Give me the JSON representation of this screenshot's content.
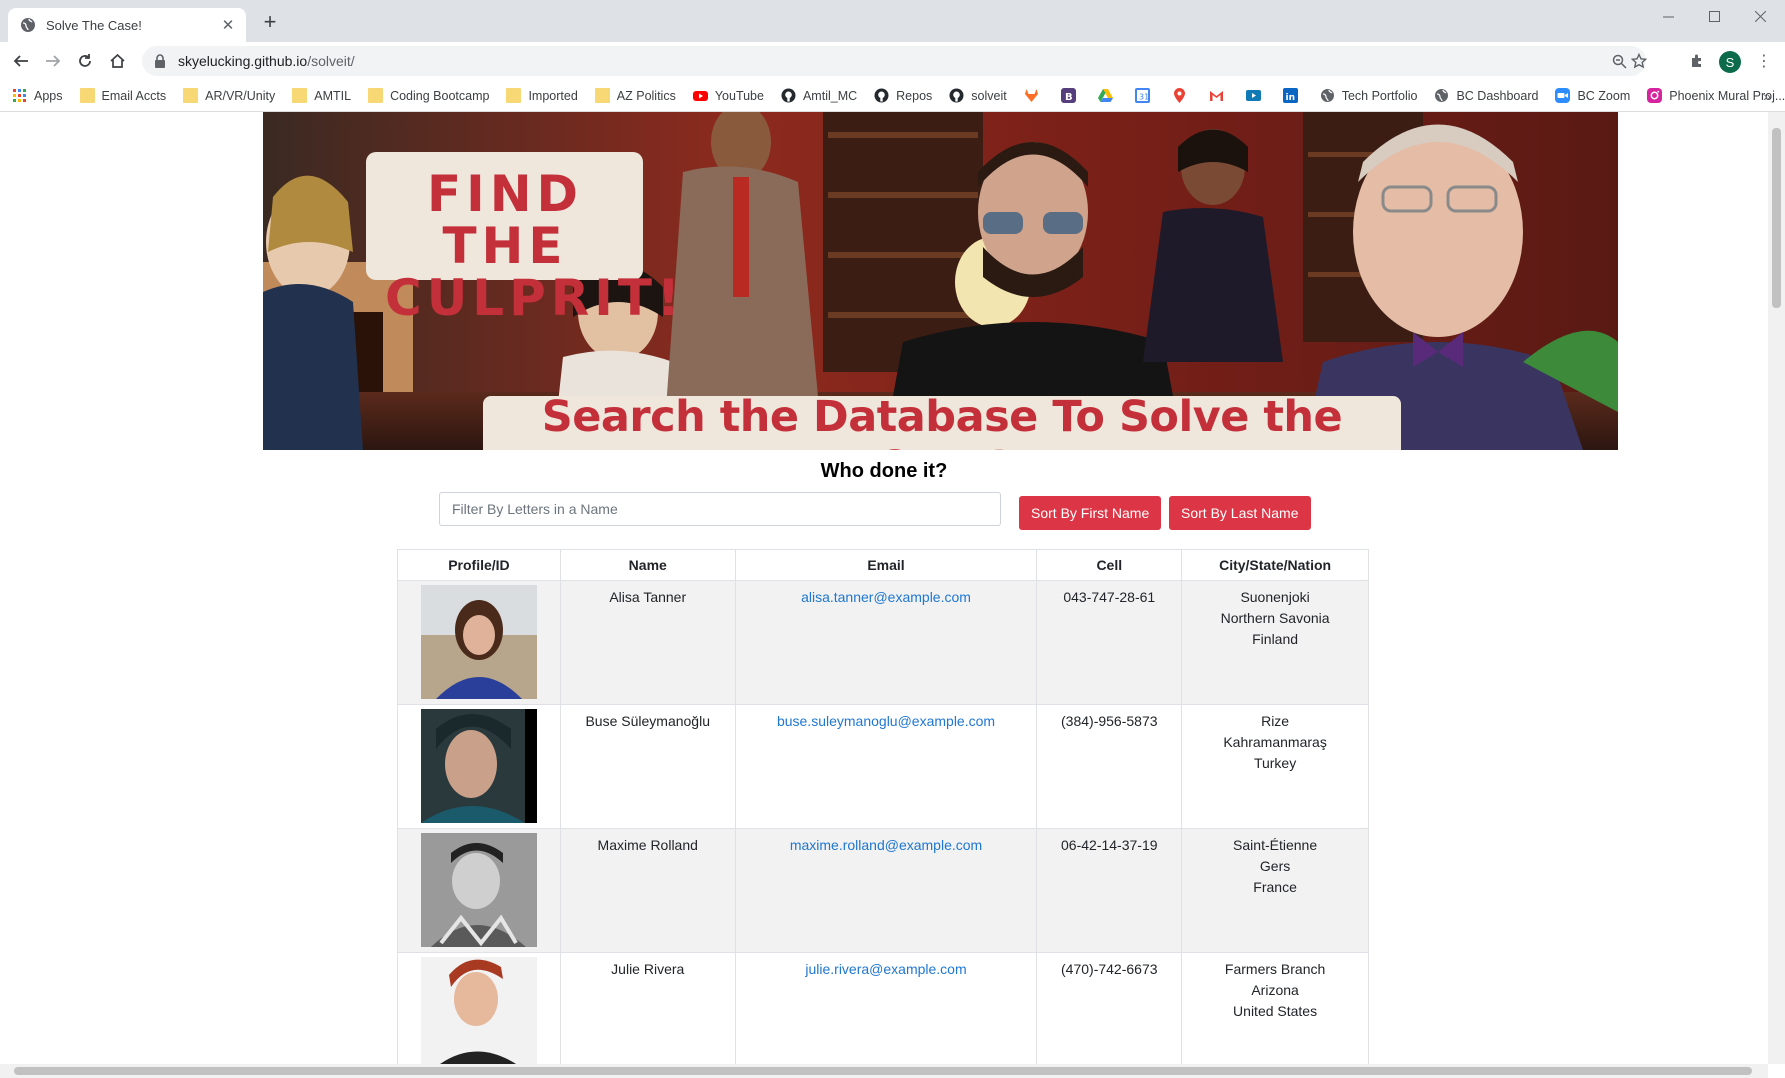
{
  "browser": {
    "tab_title": "Solve The Case!",
    "url_host": "skyelucking.github.io",
    "url_path": "/solveit/",
    "profile_initial": "S",
    "bookmarks": [
      {
        "label": "Apps",
        "icon": "apps-grid-icon"
      },
      {
        "label": "Email Accts",
        "icon": "folder-icon"
      },
      {
        "label": "AR/VR/Unity",
        "icon": "folder-icon"
      },
      {
        "label": "AMTIL",
        "icon": "folder-icon"
      },
      {
        "label": "Coding Bootcamp",
        "icon": "folder-icon"
      },
      {
        "label": "Imported",
        "icon": "folder-icon"
      },
      {
        "label": "AZ Politics",
        "icon": "folder-icon"
      },
      {
        "label": "YouTube",
        "icon": "youtube-icon"
      },
      {
        "label": "Amtil_MC",
        "icon": "github-icon"
      },
      {
        "label": "Repos",
        "icon": "github-icon"
      },
      {
        "label": "solveit",
        "icon": "github-icon"
      },
      {
        "label": "Tech Portfolio",
        "icon": "globe-icon"
      },
      {
        "label": "BC Dashboard",
        "icon": "globe-icon"
      },
      {
        "label": "BC Zoom",
        "icon": "zoom-icon"
      },
      {
        "label": "Phoenix Mural Proj...",
        "icon": "instagram-icon"
      }
    ]
  },
  "banner": {
    "title_line1": "FIND THE",
    "title_line2": "CULPRIT!",
    "subtitle": "Search the Database To Solve the Case!"
  },
  "page": {
    "heading": "Who done it?",
    "search_placeholder": "Filter By Letters in a Name",
    "sort_first_label": "Sort By First Name",
    "sort_last_label": "Sort By Last Name"
  },
  "table": {
    "headers": [
      "Profile/ID",
      "Name",
      "Email",
      "Cell",
      "City/State/Nation"
    ],
    "rows": [
      {
        "name": "Alisa Tanner",
        "email": "alisa.tanner@example.com",
        "cell": "043-747-28-61",
        "city": "Suonenjoki",
        "state": "Northern Savonia",
        "nation": "Finland"
      },
      {
        "name": "Buse Süleymanoğlu",
        "email": "buse.suleymanoglu@example.com",
        "cell": "(384)-956-5873",
        "city": "Rize",
        "state": "Kahramanmaraş",
        "nation": "Turkey"
      },
      {
        "name": "Maxime Rolland",
        "email": "maxime.rolland@example.com",
        "cell": "06-42-14-37-19",
        "city": "Saint-Étienne",
        "state": "Gers",
        "nation": "France"
      },
      {
        "name": "Julie Rivera",
        "email": "julie.rivera@example.com",
        "cell": "(470)-742-6673",
        "city": "Farmers Branch",
        "state": "Arizona",
        "nation": "United States"
      }
    ]
  },
  "colors": {
    "accent": "#dc3545",
    "banner_text": "#c4303a",
    "link": "#1f77d0"
  }
}
